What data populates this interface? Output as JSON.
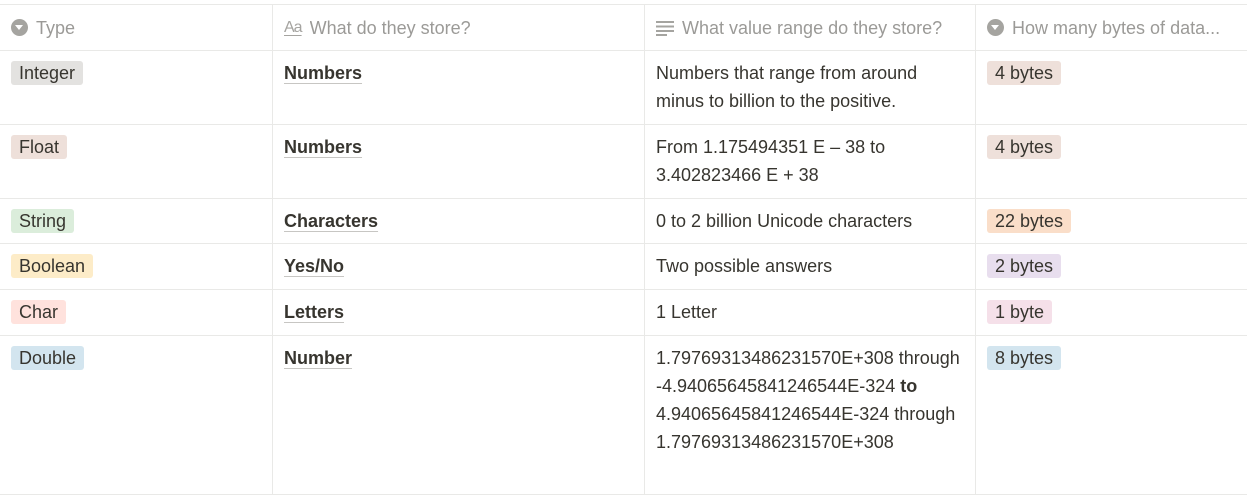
{
  "columns": [
    {
      "label": "Type",
      "icon": "select-icon"
    },
    {
      "label": "What do they store?",
      "icon": "title-aa-icon"
    },
    {
      "label": "What value range do they store?",
      "icon": "text-lines-icon"
    },
    {
      "label": "How many bytes of data...",
      "icon": "select-icon"
    }
  ],
  "rows": [
    {
      "type": {
        "label": "Integer",
        "bg": "#e3e2e0"
      },
      "stores": "Numbers",
      "range": "Numbers that range from around minus to billion to the positive.",
      "bytes": {
        "label": "4 bytes",
        "bg": "#eee0da"
      }
    },
    {
      "type": {
        "label": "Float",
        "bg": "#eee0da"
      },
      "stores": "Numbers",
      "range": "From 1.175494351 E – 38 to 3.402823466 E + 38",
      "bytes": {
        "label": "4 bytes",
        "bg": "#eee0da"
      }
    },
    {
      "type": {
        "label": "String",
        "bg": "#dbeddb"
      },
      "stores": "Characters",
      "range": "0 to 2 billion Unicode characters",
      "bytes": {
        "label": "22 bytes",
        "bg": "#fadec9"
      }
    },
    {
      "type": {
        "label": "Boolean",
        "bg": "#fdecc8"
      },
      "stores": "Yes/No",
      "range": "Two possible answers",
      "bytes": {
        "label": "2 bytes",
        "bg": "#e8deee"
      }
    },
    {
      "type": {
        "label": "Char",
        "bg": "#ffe2dd"
      },
      "stores": "Letters",
      "range": "1 Letter",
      "bytes": {
        "label": "1 byte",
        "bg": "#f5e0e9"
      }
    },
    {
      "type": {
        "label": "Double",
        "bg": "#d3e5ef"
      },
      "stores": "Number",
      "range_parts": {
        "before": "1.79769313486231570E+308 through -4.94065645841246544E-324 ",
        "bold": "to",
        "after": " 4.94065645841246544E-324 through 1.79769313486231570E+308"
      },
      "bytes": {
        "label": "8 bytes",
        "bg": "#d3e5ef"
      }
    }
  ]
}
